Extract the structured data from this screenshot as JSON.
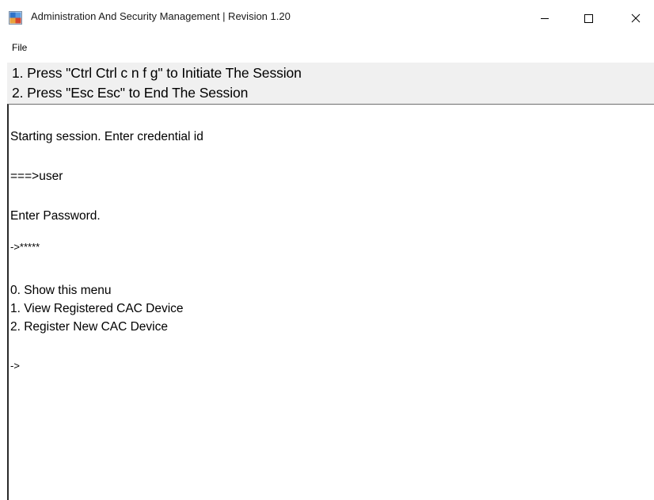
{
  "window": {
    "title": "Administration And Security Management | Revision 1.20",
    "icon": "app-window-icon"
  },
  "titlebar_buttons": {
    "minimize": "—",
    "maximize": "☐",
    "close": "✕"
  },
  "menu": {
    "file": "File"
  },
  "instructions": {
    "line1": "1. Press \"Ctrl Ctrl c n f g\" to Initiate The Session",
    "line2": "2. Press \"Esc Esc\" to End The Session"
  },
  "console": {
    "lines": [
      "Starting session. Enter credential id",
      "===>user",
      "Enter Password.",
      "->*****",
      "0. Show this menu",
      "1. View Registered CAC Device",
      "2. Register New CAC Device",
      "->"
    ]
  },
  "colors": {
    "instructions_background": "#f0f0f0",
    "console_background": "#ffffff",
    "text": "#000000"
  }
}
